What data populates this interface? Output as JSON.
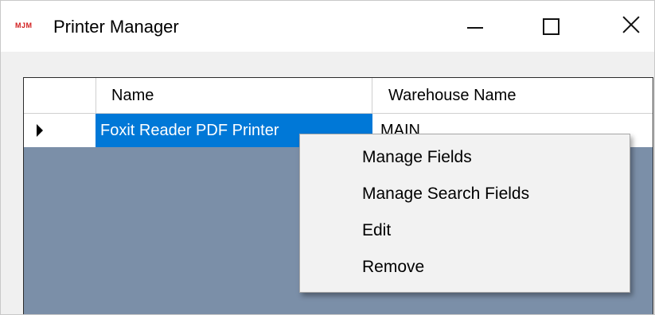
{
  "window": {
    "app_icon_text": "MJM",
    "title": "Printer Manager"
  },
  "grid": {
    "columns": [
      "Name",
      "Warehouse Name"
    ],
    "rows": [
      {
        "name": "Foxit Reader PDF Printer",
        "warehouse": "MAIN",
        "selected": true
      }
    ],
    "background_color": "#7b8fa8",
    "selection_color": "#0078d7"
  },
  "context_menu": {
    "items": [
      {
        "label": "Manage Fields"
      },
      {
        "label": "Manage Search Fields"
      },
      {
        "label": "Edit"
      },
      {
        "label": "Remove"
      }
    ]
  },
  "icons": {
    "app": "mjm-logo-icon",
    "minimize": "minimize-icon",
    "maximize": "maximize-icon",
    "close": "close-icon",
    "row_indicator": "current-row-arrow-icon"
  }
}
